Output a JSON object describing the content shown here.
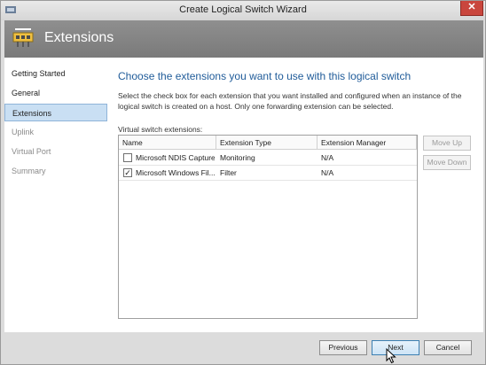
{
  "window": {
    "title": "Create Logical Switch Wizard",
    "close_glyph": "✕"
  },
  "header": {
    "title": "Extensions",
    "icon": "network-switch-icon"
  },
  "nav": {
    "items": [
      {
        "label": "Getting Started",
        "state": "normal"
      },
      {
        "label": "General",
        "state": "normal"
      },
      {
        "label": "Extensions",
        "state": "active"
      },
      {
        "label": "Uplink",
        "state": "disabled"
      },
      {
        "label": "Virtual Port",
        "state": "disabled"
      },
      {
        "label": "Summary",
        "state": "disabled"
      }
    ]
  },
  "main": {
    "heading": "Choose the extensions you want to use with this logical switch",
    "description": "Select the check box for each extension that you want installed and configured when an instance of the logical switch is created on a host. Only one forwarding extension can be selected.",
    "list_label": "Virtual switch extensions:",
    "columns": [
      "Name",
      "Extension Type",
      "Extension Manager"
    ],
    "rows": [
      {
        "checked": false,
        "check_glyph": "",
        "name": "Microsoft NDIS Capture",
        "type": "Monitoring",
        "manager": "N/A"
      },
      {
        "checked": true,
        "check_glyph": "✓",
        "name": "Microsoft Windows Fil...",
        "type": "Filter",
        "manager": "N/A"
      }
    ],
    "move_up_label": "Move Up",
    "move_down_label": "Move Down"
  },
  "footer": {
    "previous_label": "Previous",
    "next_label": "Next",
    "cancel_label": "Cancel"
  },
  "colors": {
    "accent": "#1f5b99",
    "selection": "#c9dff3",
    "header_band": "#858585",
    "close": "#c9463d"
  }
}
